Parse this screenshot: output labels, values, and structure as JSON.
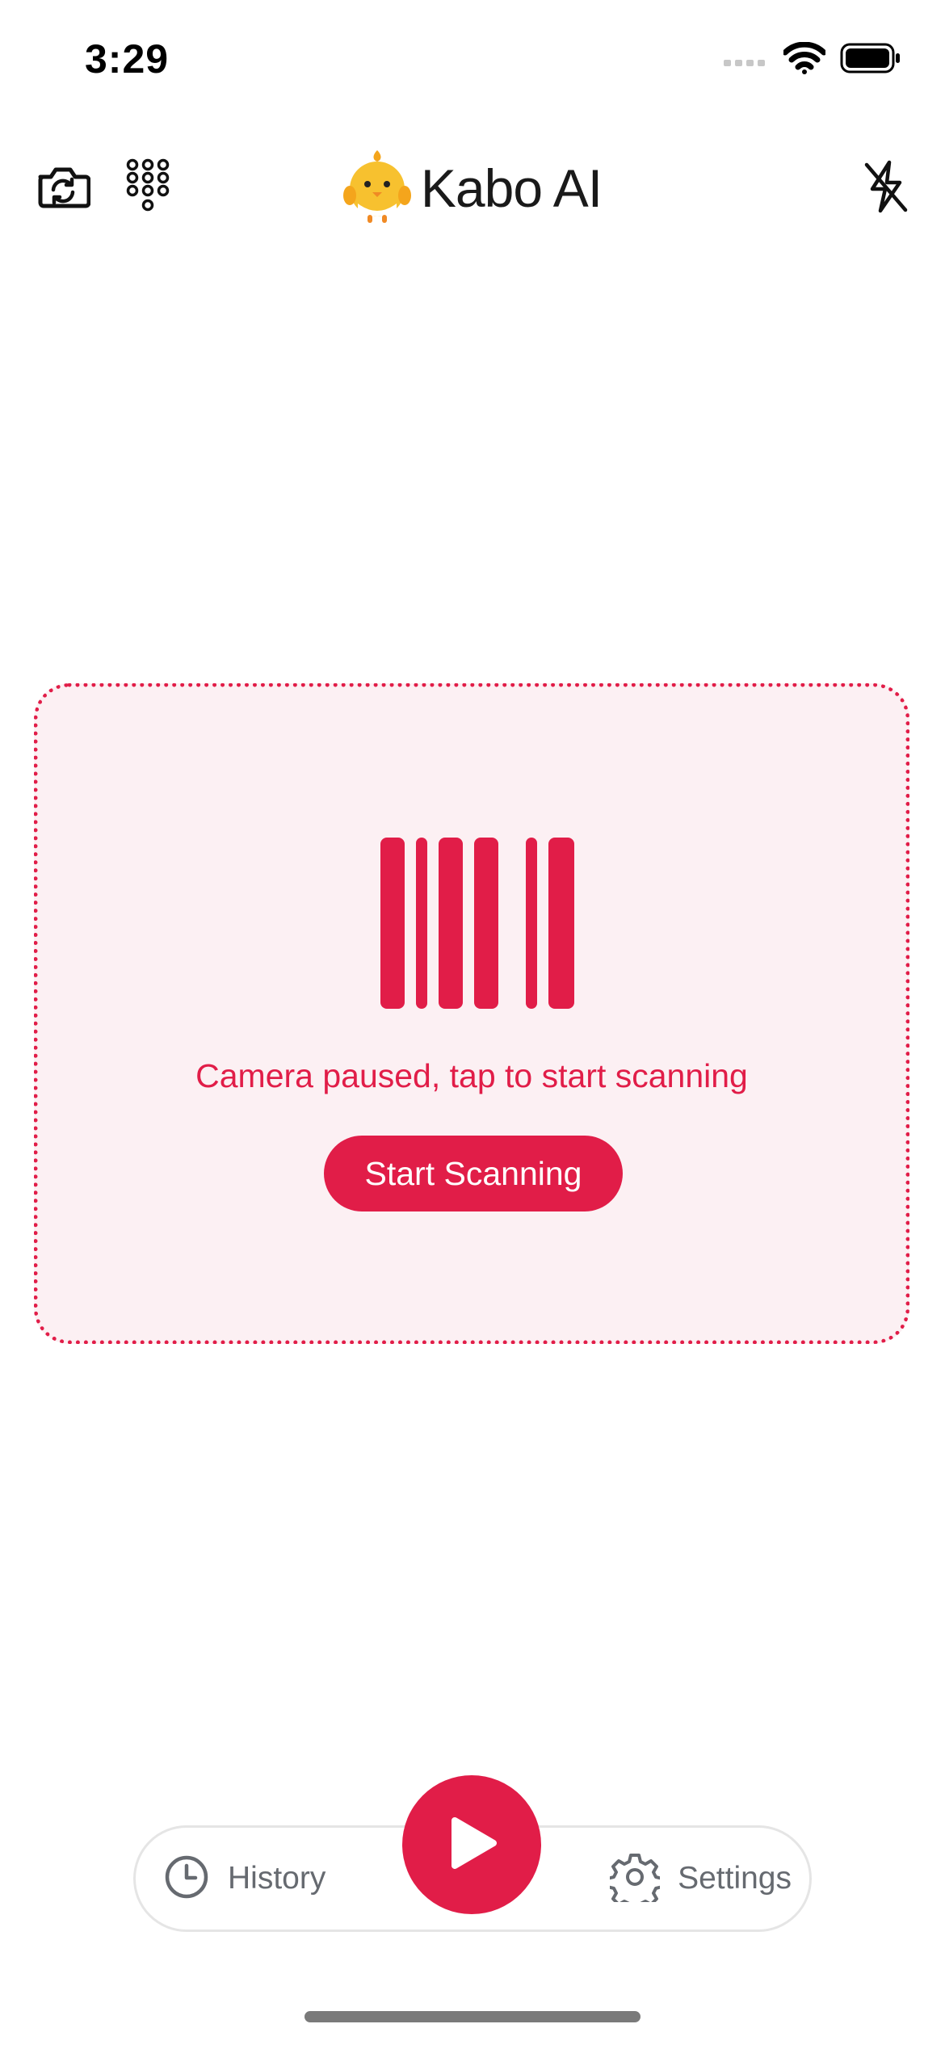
{
  "status_bar": {
    "time": "3:29",
    "icons": [
      "cellular-signal-icon",
      "wifi-icon",
      "battery-icon"
    ]
  },
  "header": {
    "left_icons": [
      "camera-flip-icon",
      "keypad-icon"
    ],
    "brand_icon": "chick-mascot-icon",
    "title": "Kabo AI",
    "right_icon": "flash-off-icon"
  },
  "scanner": {
    "icon": "barcode-icon",
    "message": "Camera paused, tap to start scanning",
    "button_label": "Start Scanning"
  },
  "bottom_nav": {
    "history_icon": "clock-icon",
    "history_label": "History",
    "play_icon": "play-icon",
    "settings_icon": "gear-icon",
    "settings_label": "Settings"
  },
  "colors": {
    "accent": "#e11d48",
    "card_background": "#fcf0f3",
    "nav_label": "#666a70"
  }
}
